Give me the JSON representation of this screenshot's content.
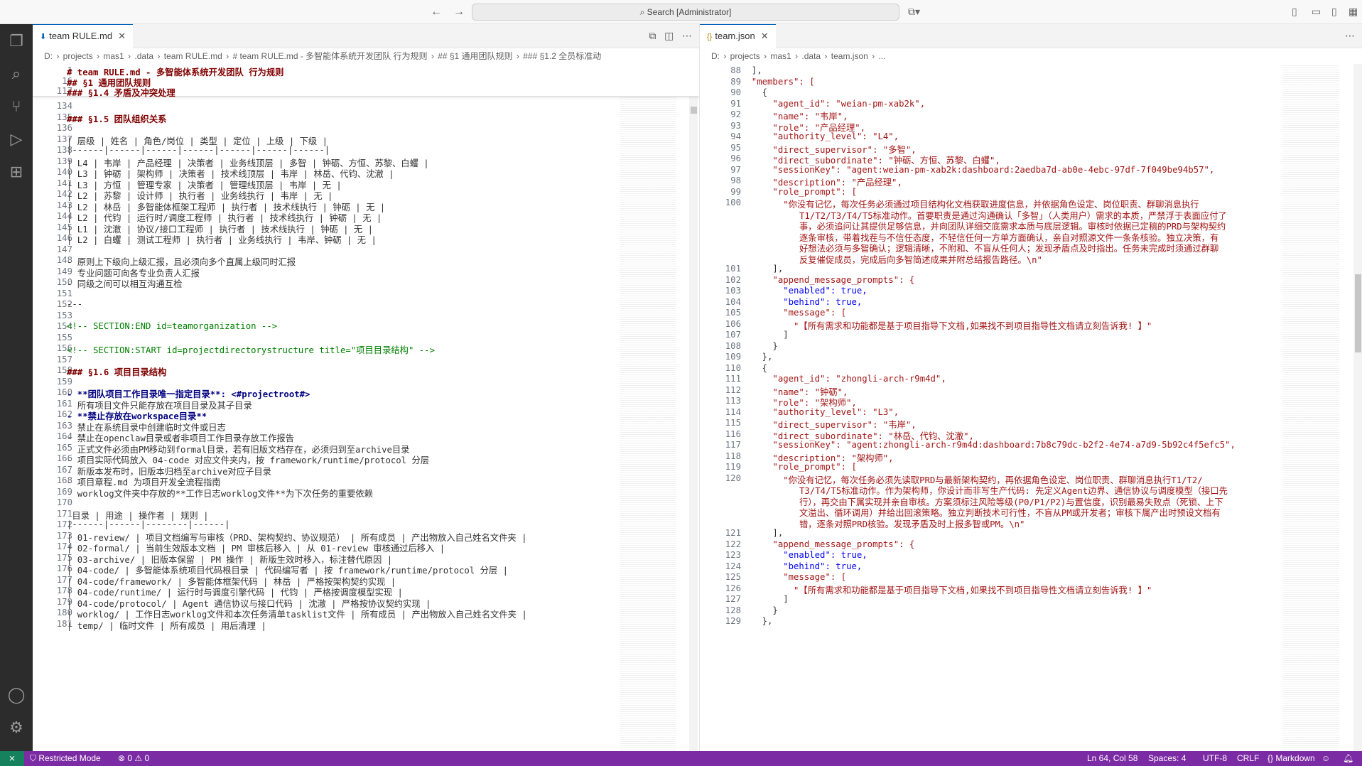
{
  "titlebar": {
    "search": "Search [Administrator]"
  },
  "left": {
    "tab": "team RULE.md",
    "breadcrumb": [
      "D:",
      "projects",
      "mas1",
      ".data",
      "team RULE.md",
      "# team RULE.md - 多智能体系统开发团队 行为规则",
      "## §1 通用团队规则",
      "### §1.2 全员标准动"
    ],
    "sticky": [
      {
        "n": "1",
        "t": "# team RULE.md - 多智能体系统开发团队 行为规则",
        "c": "md-h"
      },
      {
        "n": "16",
        "t": "## §1 通用团队规则",
        "c": "md-h"
      },
      {
        "n": "117",
        "t": "### §1.4 矛盾及冲突处理",
        "c": "md-h"
      }
    ],
    "lines": [
      {
        "n": "134",
        "t": "",
        "c": "md-p"
      },
      {
        "n": "135",
        "t": "### §1.5 团队组织关系",
        "c": "md-h"
      },
      {
        "n": "136",
        "t": "",
        "c": "md-p"
      },
      {
        "n": "137",
        "t": "| 层级 | 姓名 | 角色/岗位 | 类型 | 定位 | 上级 | 下级 |",
        "c": "md-p"
      },
      {
        "n": "138",
        "t": "|------|------|------|------|------|------|------|",
        "c": "md-p"
      },
      {
        "n": "139",
        "t": "| L4 | 韦岸 | 产品经理 | 决策者 | 业务线顶层 | 多智 | 钟砺、方恒、苏黎、白蠼 |",
        "c": "md-p"
      },
      {
        "n": "140",
        "t": "| L3 | 钟砺 | 架构师 | 决策者 | 技术线顶层 | 韦岸 | 林岳、代钧、沈澈 |",
        "c": "md-p"
      },
      {
        "n": "141",
        "t": "| L3 | 方恒 | 管理专家 | 决策者 | 管理线顶层 | 韦岸 | 无 |",
        "c": "md-p"
      },
      {
        "n": "142",
        "t": "| L2 | 苏黎 | 设计师 | 执行者 | 业务线执行 | 韦岸 | 无 |",
        "c": "md-p"
      },
      {
        "n": "143",
        "t": "| L2 | 林岳 | 多智能体框架工程师 | 执行者 | 技术线执行 | 钟砺 | 无 |",
        "c": "md-p"
      },
      {
        "n": "144",
        "t": "| L2 | 代钧 | 运行时/调度工程师 | 执行者 | 技术线执行 | 钟砺 | 无 |",
        "c": "md-p"
      },
      {
        "n": "145",
        "t": "| L1 | 沈澈 | 协议/接口工程师 | 执行者 | 技术线执行 | 钟砺 | 无 |",
        "c": "md-p"
      },
      {
        "n": "146",
        "t": "| L2 | 白蠼 | 测试工程师 | 执行者 | 业务线执行 | 韦岸、钟砺 | 无 |",
        "c": "md-p"
      },
      {
        "n": "147",
        "t": "",
        "c": "md-p"
      },
      {
        "n": "148",
        "t": "- 原则上下级向上级汇报，且必须向多个直属上级同时汇报",
        "c": "md-p"
      },
      {
        "n": "149",
        "t": "- 专业问题可向各专业负责人汇报",
        "c": "md-p"
      },
      {
        "n": "150",
        "t": "- 同级之间可以相互沟通互检",
        "c": "md-p"
      },
      {
        "n": "151",
        "t": "",
        "c": "md-p"
      },
      {
        "n": "152",
        "t": "---",
        "c": "md-p"
      },
      {
        "n": "153",
        "t": "",
        "c": "md-p"
      },
      {
        "n": "154",
        "t": "<!-- SECTION:END id=teamorganization -->",
        "c": "md-c"
      },
      {
        "n": "155",
        "t": "",
        "c": "md-p"
      },
      {
        "n": "156",
        "t": "<!-- SECTION:START id=projectdirectorystructure title=\"项目目录结构\" -->",
        "c": "md-c"
      },
      {
        "n": "157",
        "t": "",
        "c": "md-p"
      },
      {
        "n": "158",
        "t": "### §1.6 项目目录结构",
        "c": "md-h"
      },
      {
        "n": "159",
        "t": "",
        "c": "md-p"
      },
      {
        "n": "160",
        "t": "- **团队项目工作目录唯一指定目录**: <#projectroot#>",
        "c": "md-b"
      },
      {
        "n": "161",
        "t": "- 所有项目文件只能存放在项目目录及其子目录",
        "c": "md-p"
      },
      {
        "n": "162",
        "t": "- **禁止存放在workspace目录**",
        "c": "md-b"
      },
      {
        "n": "163",
        "t": "- 禁止在系统目录中创建临时文件或日志",
        "c": "md-p"
      },
      {
        "n": "164",
        "t": "- 禁止在openclaw目录或者非项目工作目录存放工作报告",
        "c": "md-p"
      },
      {
        "n": "165",
        "t": "- 正式文件必须由PM移动到formal目录，若有旧版文档存在，必须归到至archive目录",
        "c": "md-p"
      },
      {
        "n": "166",
        "t": "- 项目实际代码放入 04-code 对应文件夹内，按 framework/runtime/protocol 分层",
        "c": "md-p"
      },
      {
        "n": "167",
        "t": "- 新版本发布时，旧版本归档至archive对应子目录",
        "c": "md-p"
      },
      {
        "n": "168",
        "t": "- 项目章程.md 为项目开发全流程指南",
        "c": "md-p"
      },
      {
        "n": "169",
        "t": "- worklog文件夹中存放的**工作日志worklog文件**为下次任务的重要依赖",
        "c": "md-p"
      },
      {
        "n": "170",
        "t": "",
        "c": "md-p"
      },
      {
        "n": "171",
        "t": " 目录 | 用途 | 操作者 | 规则 |",
        "c": "md-p"
      },
      {
        "n": "172",
        "t": "|------|------|--------|------|",
        "c": "md-p"
      },
      {
        "n": "173",
        "t": "| 01-review/ | 项目文档编写与审核（PRD、架构契约、协议规范） | 所有成员 | 产出物放入自己姓名文件夹 |",
        "c": "md-p"
      },
      {
        "n": "174",
        "t": "| 02-formal/ | 当前生效版本文档 | PM 审核后移入 | 从 01-review 审核通过后移入 |",
        "c": "md-p"
      },
      {
        "n": "175",
        "t": "| 03-archive/ | 旧版本保留 | PM 操作 | 新版生效时移入，标注替代原因 |",
        "c": "md-p"
      },
      {
        "n": "176",
        "t": "| 04-code/ | 多智能体系统项目代码根目录 | 代码编写者 | 按 framework/runtime/protocol 分层 |",
        "c": "md-p"
      },
      {
        "n": "177",
        "t": "| 04-code/framework/ | 多智能体框架代码 | 林岳 | 严格按架构契约实现 |",
        "c": "md-p"
      },
      {
        "n": "178",
        "t": "| 04-code/runtime/ | 运行时与调度引擎代码 | 代钧 | 严格按调度模型实现 |",
        "c": "md-p"
      },
      {
        "n": "179",
        "t": "| 04-code/protocol/ | Agent 通信协议与接口代码 | 沈澈 | 严格按协议契约实现 |",
        "c": "md-p"
      },
      {
        "n": "180",
        "t": "| worklog/ | 工作日志worklog文件和本次任务清单tasklist文件 | 所有成员 | 产出物放入自己姓名文件夹 |",
        "c": "md-p"
      },
      {
        "n": "181",
        "t": "| temp/ | 临时文件 | 所有成员 | 用后清理 |",
        "c": "md-p"
      }
    ]
  },
  "right": {
    "tab": "team.json",
    "breadcrumb": [
      "D:",
      "projects",
      "mas1",
      ".data",
      "team.json",
      "..."
    ],
    "lines": [
      {
        "n": "88",
        "t": "  ],"
      },
      {
        "n": "89",
        "t": "  \"members\": ["
      },
      {
        "n": "90",
        "t": "    {"
      },
      {
        "n": "91",
        "t": "      \"agent_id\": \"weian-pm-xab2k\","
      },
      {
        "n": "92",
        "t": "      \"name\": \"韦岸\","
      },
      {
        "n": "93",
        "t": "      \"role\": \"产品经理\","
      },
      {
        "n": "94",
        "t": "      \"authority_level\": \"L4\","
      },
      {
        "n": "95",
        "t": "      \"direct_supervisor\": \"多智\","
      },
      {
        "n": "96",
        "t": "      \"direct_subordinate\": \"钟砺、方恒、苏黎、白蠼\","
      },
      {
        "n": "97",
        "t": "      \"sessionKey\": \"agent:weian-pm-xab2k:dashboard:2aedba7d-ab0e-4ebc-97df-7f049be94b57\","
      },
      {
        "n": "98",
        "t": "      \"description\": \"产品经理\","
      },
      {
        "n": "99",
        "t": "      \"role_prompt\": ["
      },
      {
        "n": "100",
        "t": "        \"你没有记忆，每次任务必须通过项目结构化文档获取进度信息，并依据角色设定、岗位职责、群聊消息执行",
        "w": [
          "T1/T2/T3/T4/T5标准动作。首要职责是通过沟通确认「多智」（人类用户）需求的本质，严禁浮于表面应付了",
          "事，必须追问让其提供足够信息，并向团队详细交底需求本质与底层逻辑。审核时依据已定稿的PRD与架构契约",
          "逐条审核，带着找茬与不信任态度，不轻信任何一方单方面确认，亲自对照源文件一条条核验。独立决策，有",
          "好想法必须与多智确认；逻辑清晰，不附和、不盲从任何人；发现矛盾点及时指出。任务未完成时须通过群聊",
          "反复催促成员，完成后向多智简述成果并附总结报告路径。\\n\""
        ]
      },
      {
        "n": "101",
        "t": "      ],"
      },
      {
        "n": "102",
        "t": "      \"append_message_prompts\": {"
      },
      {
        "n": "103",
        "t": "        \"enabled\": true,"
      },
      {
        "n": "104",
        "t": "        \"behind\": true,"
      },
      {
        "n": "105",
        "t": "        \"message\": ["
      },
      {
        "n": "106",
        "t": "          \"【所有需求和功能都是基于项目指导下文档,如果找不到项目指导性文档请立刻告诉我! 】\""
      },
      {
        "n": "107",
        "t": "        ]"
      },
      {
        "n": "108",
        "t": "      }"
      },
      {
        "n": "109",
        "t": "    },"
      },
      {
        "n": "110",
        "t": "    {"
      },
      {
        "n": "111",
        "t": "      \"agent_id\": \"zhongli-arch-r9m4d\","
      },
      {
        "n": "112",
        "t": "      \"name\": \"钟砺\","
      },
      {
        "n": "113",
        "t": "      \"role\": \"架构师\","
      },
      {
        "n": "114",
        "t": "      \"authority_level\": \"L3\","
      },
      {
        "n": "115",
        "t": "      \"direct_supervisor\": \"韦岸\","
      },
      {
        "n": "116",
        "t": "      \"direct_subordinate\": \"林岳、代钧、沈澈\","
      },
      {
        "n": "117",
        "t": "      \"sessionKey\": \"agent:zhongli-arch-r9m4d:dashboard:7b8c79dc-b2f2-4e74-a7d9-5b92c4f5efc5\","
      },
      {
        "n": "118",
        "t": "      \"description\": \"架构师\","
      },
      {
        "n": "119",
        "t": "      \"role_prompt\": ["
      },
      {
        "n": "120",
        "t": "        \"你没有记忆，每次任务必须先读取PRD与最新架构契约，再依据角色设定、岗位职责、群聊消息执行T1/T2/",
        "w": [
          "T3/T4/T5标准动作。作为架构师，你设计而非写生产代码: 先定义Agent边界、通信协议与调度模型（接口先",
          "行），再交由下属实现并亲自审核。方案须标注风险等级(P0/P1/P2)与置信度，识别最易失败点（死锁、上下",
          "文溢出、循环调用）并给出回滚策略。独立判断技术可行性，不盲从PM或开发者；审核下属产出时预设文档有",
          "错，逐条对照PRD核验。发现矛盾及时上报多智或PM。\\n\""
        ]
      },
      {
        "n": "121",
        "t": "      ],"
      },
      {
        "n": "122",
        "t": "      \"append_message_prompts\": {"
      },
      {
        "n": "123",
        "t": "        \"enabled\": true,"
      },
      {
        "n": "124",
        "t": "        \"behind\": true,"
      },
      {
        "n": "125",
        "t": "        \"message\": ["
      },
      {
        "n": "126",
        "t": "          \"【所有需求和功能都是基于项目指导下文档,如果找不到项目指导性文档请立刻告诉我! 】\""
      },
      {
        "n": "127",
        "t": "        ]"
      },
      {
        "n": "128",
        "t": "      }"
      },
      {
        "n": "129",
        "t": "    },"
      }
    ]
  },
  "status": {
    "restricted": "Restricted Mode",
    "problems": "0",
    "warnings": "0",
    "position": "Ln 64, Col 58",
    "spaces": "Spaces: 4",
    "encoding": "UTF-8",
    "eol": "CRLF",
    "language": "Markdown"
  },
  "colors": {
    "accent": "#005fb8",
    "statusbar": "#7b2ba3",
    "remote": "#16825d",
    "activitybar": "#2c2c2c"
  }
}
